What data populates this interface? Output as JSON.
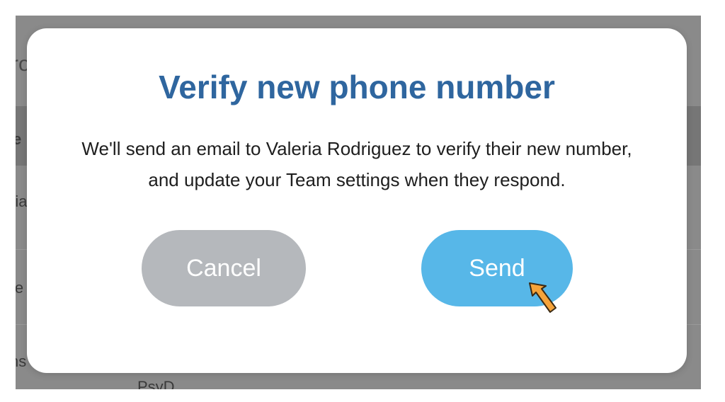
{
  "background": {
    "fragments": [
      "ro",
      "e",
      "ria",
      "ie",
      "ns",
      "PsyD"
    ]
  },
  "dialog": {
    "title": "Verify new phone number",
    "message": "We'll send an email to Valeria Rodriguez to verify their new number, and update your Team settings when they respond.",
    "cancel_label": "Cancel",
    "send_label": "Send"
  },
  "colors": {
    "title": "#2f669f",
    "cancel_button": "#b5b8bc",
    "send_button": "#57b7e8",
    "cursor": "#f5a33a"
  },
  "icons": {
    "cursor": "arrow-cursor-icon"
  }
}
